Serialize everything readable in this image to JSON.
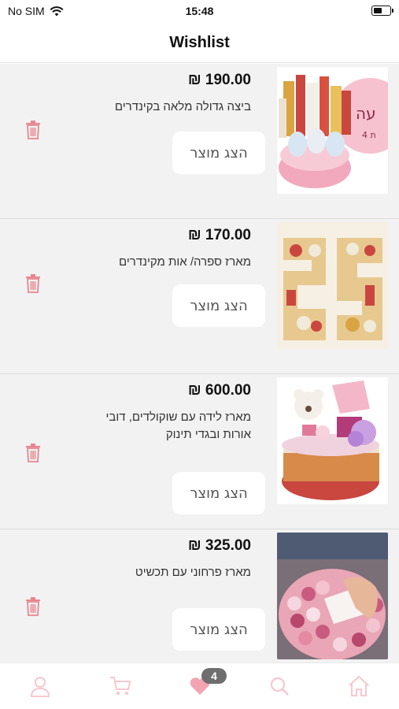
{
  "status_bar": {
    "carrier": "No SIM",
    "time": "15:48"
  },
  "header": {
    "title": "Wishlist"
  },
  "wishlist": {
    "items": [
      {
        "price": "₪ 190.00",
        "name": "ביצה גדולה מלאה בקינדרים",
        "view_label": "הצג מוצר"
      },
      {
        "price": "₪ 170.00",
        "name": "מארז ספרה/ אות מקינדרים",
        "view_label": "הצג מוצר"
      },
      {
        "price": "₪ 600.00",
        "name": "מארז לידה עם שוקולדים, דובי אורות ובגדי תינוק",
        "view_label": "הצג מוצר"
      },
      {
        "price": "₪ 325.00",
        "name": "מארז פרחוני עם תכשיט",
        "view_label": "הצג מוצר"
      }
    ]
  },
  "tab_bar": {
    "wishlist_count": "4",
    "icons": [
      "user-icon",
      "cart-icon",
      "heart-icon",
      "search-icon",
      "home-icon"
    ],
    "active_color": "#f3a3b1",
    "inactive_color": "#f7c7cf"
  },
  "colors": {
    "trash": "#e8868f",
    "list_bg": "#f2f2f2"
  }
}
